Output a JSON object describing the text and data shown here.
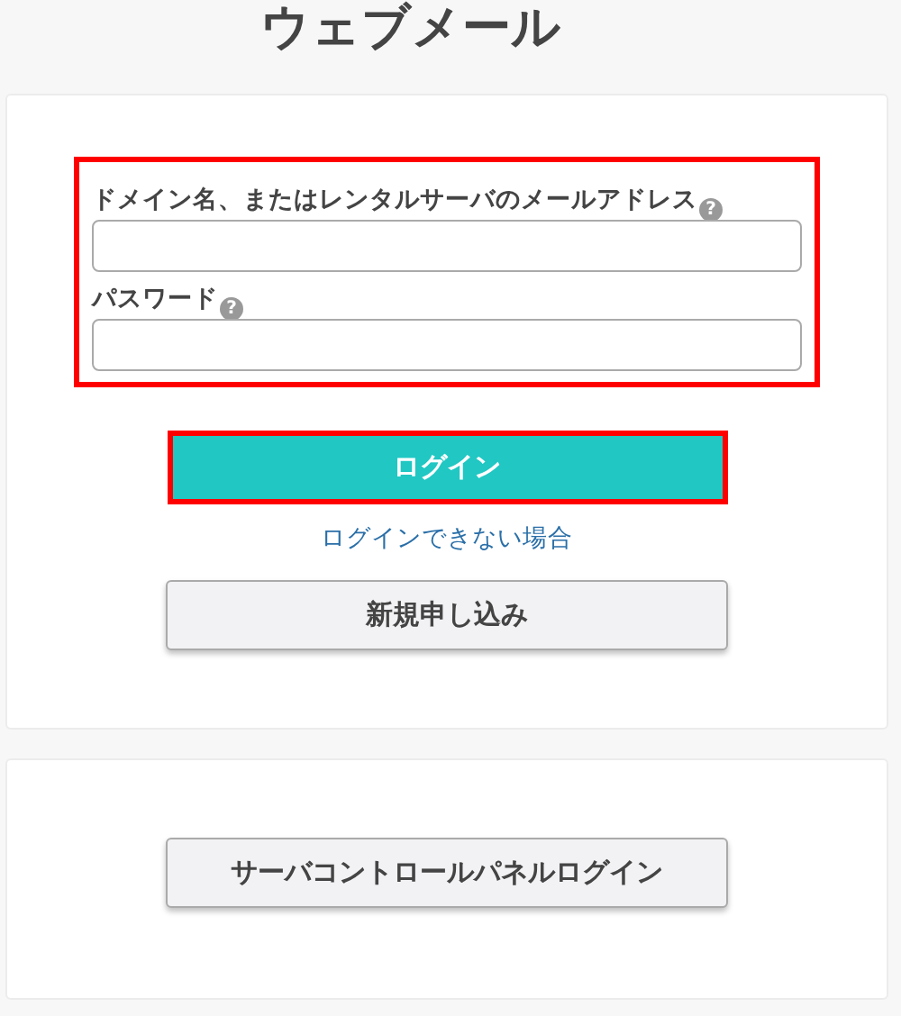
{
  "title": "ウェブメール",
  "login_form": {
    "highlighted": true,
    "fields": [
      {
        "label": "ドメイン名、またはレンタルサーバのメールアドレス",
        "help": "?"
      },
      {
        "label": "パスワード",
        "help": "?"
      }
    ],
    "login_button": {
      "label": "ログイン",
      "highlighted": true
    },
    "help_link": "ログインできない場合",
    "signup_button": "新規申し込み"
  },
  "server_panel": {
    "button": "サーバコントロールパネルログイン"
  }
}
